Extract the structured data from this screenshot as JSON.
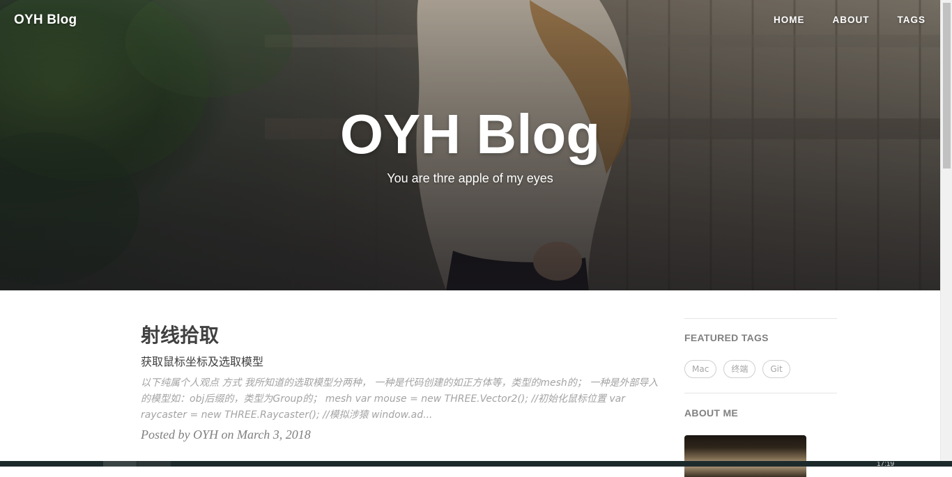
{
  "header": {
    "brand": "OYH Blog",
    "nav": [
      "HOME",
      "ABOUT",
      "TAGS"
    ],
    "hero_title": "OYH Blog",
    "hero_subtitle": "You are thre apple of my eyes"
  },
  "post": {
    "title": "射线拾取",
    "subtitle": "获取鼠标坐标及选取模型",
    "excerpt": "以下纯属个人观点 方式 我所知道的选取模型分两种， 一种是代码创建的如正方体等，类型的mesh的； 一种是外部导入的模型如：obj后缀的，类型为Group的； mesh var mouse = new THREE.Vector2(); //初始化鼠标位置 var raycaster = new THREE.Raycaster(); //模拟涉猿 window.ad...",
    "meta": "Posted by OYH on March 3, 2018"
  },
  "sidebar": {
    "featured_tags_heading": "FEATURED TAGS",
    "tags": [
      "Mac",
      "终端",
      "Git"
    ],
    "about_heading": "ABOUT ME"
  },
  "taskbar": {
    "clock": "17:19"
  },
  "colors": {
    "heading_text": "#404040",
    "muted_text": "#808080",
    "excerpt_text": "#a3a3a3",
    "tag_border": "#cfcfcf",
    "hero_text": "#ffffff"
  }
}
